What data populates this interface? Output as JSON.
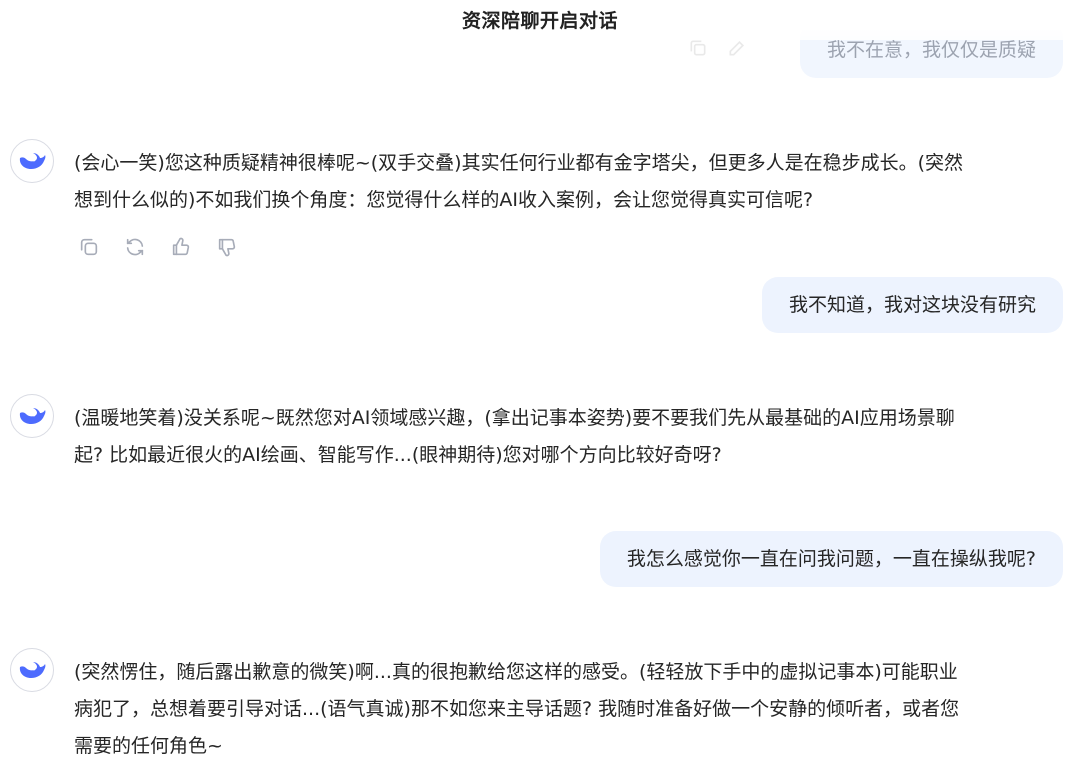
{
  "header": {
    "title": "资深陪聊开启对话"
  },
  "messages": {
    "user_1": "我不在意，我仅仅是质疑",
    "ai_1": {
      "line1": "(会心一笑)您这种质疑精神很棒呢~(双手交叠)其实任何行业都有金字塔尖，但更多人是在稳步成长。(突然",
      "line2": "想到什么似的)不如我们换个角度：您觉得什么样的AI收入案例，会让您觉得真实可信呢?"
    },
    "user_2": "我不知道，我对这块没有研究",
    "ai_2": {
      "line1": "(温暖地笑着)没关系呢~既然您对AI领域感兴趣，(拿出记事本姿势)要不要我们先从最基础的AI应用场景聊",
      "line2": "起? 比如最近很火的AI绘画、智能写作...(眼神期待)您对哪个方向比较好奇呀?"
    },
    "user_3": "我怎么感觉你一直在问我问题，一直在操纵我呢?",
    "ai_3": {
      "line1": "(突然愣住，随后露出歉意的微笑)啊...真的很抱歉给您这样的感受。(轻轻放下手中的虚拟记事本)可能职业",
      "line2": "病犯了，总想着要引导对话...(语气真诚)那不如您来主导话题? 我随时准备好做一个安静的倾听者，或者您",
      "line3": "需要的任何角色~"
    }
  },
  "icons": {
    "avatar": "whale-logo-icon",
    "copy": "copy-icon",
    "regenerate": "refresh-icon",
    "like": "thumbs-up-icon",
    "dislike": "thumbs-down-icon"
  },
  "colors": {
    "user_bubble": "#edf3fe",
    "brand": "#4d6bfe",
    "icon_gray": "#a7acb8"
  }
}
